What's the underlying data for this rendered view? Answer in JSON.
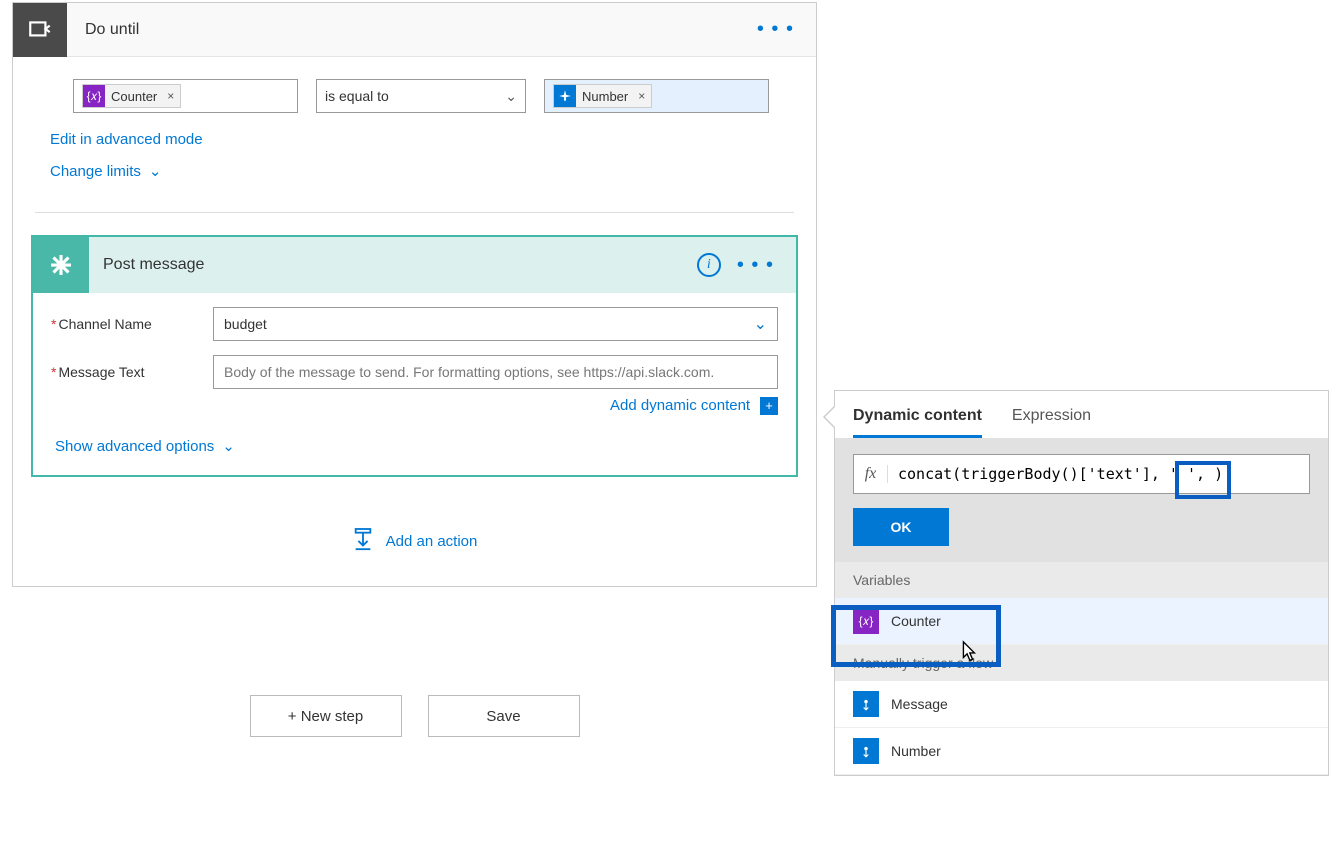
{
  "do_until": {
    "title": "Do until",
    "token_left": "Counter",
    "operator": "is equal to",
    "token_right": "Number",
    "edit_advanced": "Edit in advanced mode",
    "change_limits": "Change limits"
  },
  "post_message": {
    "title": "Post message",
    "channel_label": "Channel Name",
    "channel_value": "budget",
    "message_label": "Message Text",
    "message_placeholder": "Body of the message to send. For formatting options, see https://api.slack.com.",
    "add_dynamic": "Add dynamic content",
    "show_advanced": "Show advanced options"
  },
  "add_action": "Add an action",
  "footer": {
    "new_step": "+ New step",
    "save": "Save"
  },
  "dyn": {
    "tab_dynamic": "Dynamic content",
    "tab_expression": "Expression",
    "fx": "fx",
    "expr": "concat(triggerBody()['text'], ' ', )",
    "ok": "OK",
    "section_variables": "Variables",
    "item_counter": "Counter",
    "section_trigger": "Manually trigger a flow",
    "item_message": "Message",
    "item_number": "Number"
  }
}
